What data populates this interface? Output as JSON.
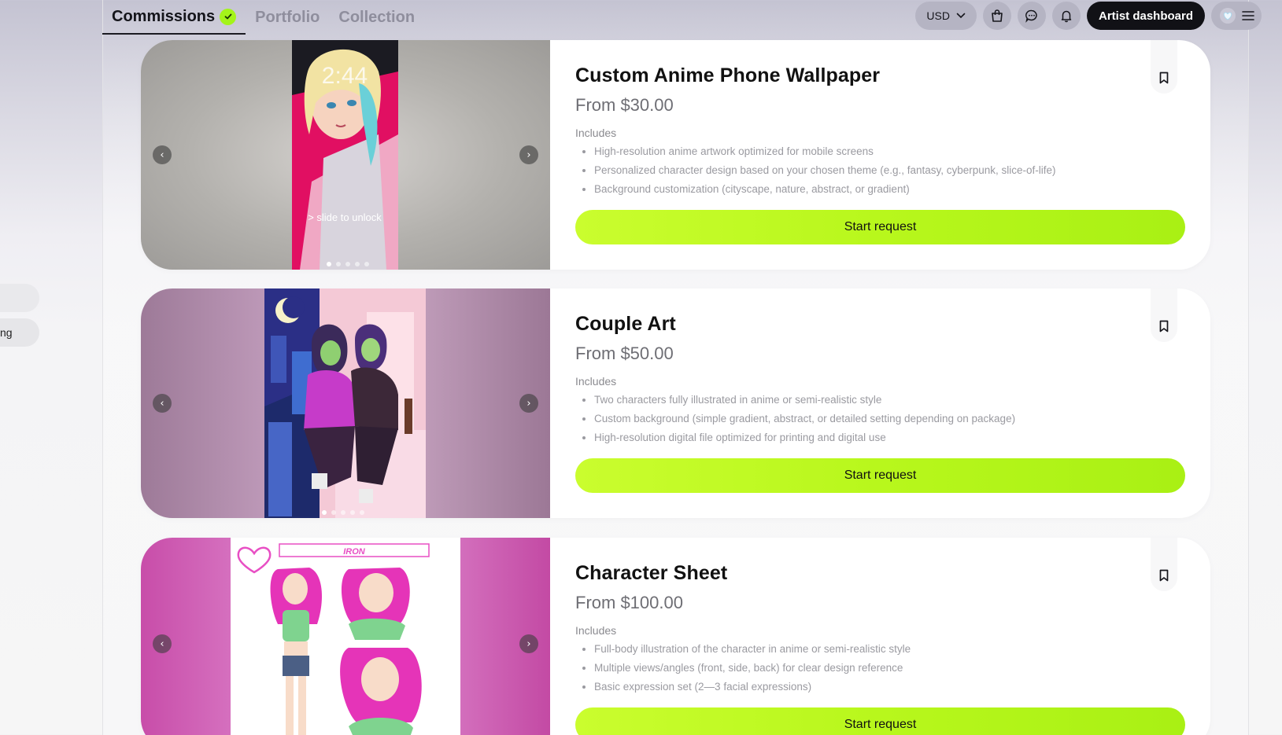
{
  "nav": {
    "tabs": [
      {
        "label": "Commissions",
        "active": true
      },
      {
        "label": "Portfolio",
        "active": false
      },
      {
        "label": "Collection",
        "active": false
      }
    ],
    "currency": "USD",
    "artist_dashboard": "Artist dashboard"
  },
  "sidebar": {
    "items": [
      "",
      "ng"
    ]
  },
  "cards": [
    {
      "title": "Custom Anime Phone Wallpaper",
      "price": "From $30.00",
      "includes_label": "Includes",
      "includes": [
        "High-resolution anime artwork optimized for mobile screens",
        "Personalized character design based on your chosen theme (e.g., fantasy, cyberpunk, slice-of-life)",
        "Background customization (cityscape, nature, abstract, or gradient)"
      ],
      "button": "Start request",
      "image_text": {
        "time": "2:44",
        "unlock": "> slide to unlock"
      }
    },
    {
      "title": "Couple Art",
      "price": "From $50.00",
      "includes_label": "Includes",
      "includes": [
        "Two characters fully illustrated in anime or semi-realistic style",
        "Custom background (simple gradient, abstract, or detailed setting depending on package)",
        "High-resolution digital file optimized for printing and digital use"
      ],
      "button": "Start request"
    },
    {
      "title": "Character Sheet",
      "price": "From $100.00",
      "includes_label": "Includes",
      "includes": [
        "Full-body illustration of the character in anime or semi-realistic style",
        "Multiple views/angles (front, side, back) for clear design reference",
        "Basic expression set (2—3 facial expressions)"
      ],
      "button": "Start request",
      "image_text": {
        "sheet_label": "IRON"
      }
    }
  ],
  "colors": {
    "accent": "#b8f71c",
    "dark_button": "#111116",
    "verified_badge": "#a4f41a"
  },
  "icons": [
    "check-icon",
    "chevron-down-icon",
    "shopping-bag-icon",
    "chat-bubble-icon",
    "bell-icon",
    "heart-avatar-icon",
    "hamburger-menu-icon",
    "bookmark-icon",
    "chevron-left-icon",
    "chevron-right-icon"
  ]
}
